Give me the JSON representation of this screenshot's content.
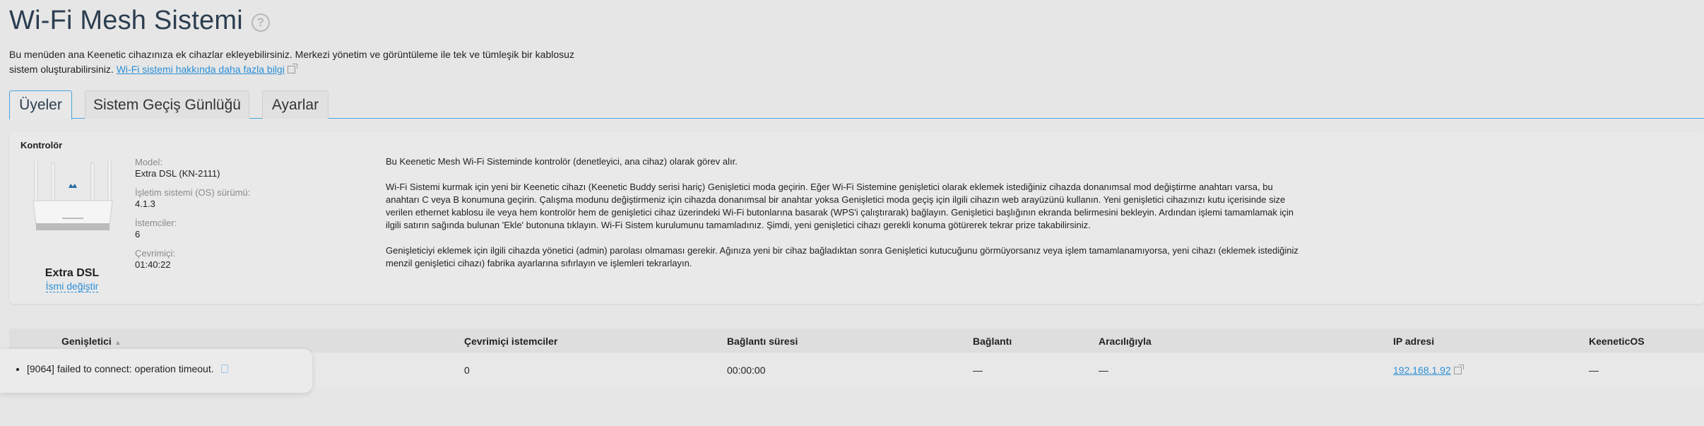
{
  "page": {
    "title": "Wi-Fi Mesh Sistemi",
    "help_icon": "?",
    "description_line1": "Bu menüden ana Keenetic cihazınıza ek cihazlar ekleyebilirsiniz. Merkezi yönetim ve görüntüleme ile tek ve tümleşik bir kablosuz",
    "description_line2": "sistem oluşturabilirsiniz.",
    "description_link": "Wi-Fi sistemi hakkında daha fazla bilgi"
  },
  "tabs": [
    {
      "label": "Üyeler",
      "active": true
    },
    {
      "label": "Sistem Geçiş Günlüğü",
      "active": false
    },
    {
      "label": "Ayarlar",
      "active": false
    }
  ],
  "controller": {
    "section_label": "Kontrolör",
    "device_name": "Extra DSL",
    "rename_link": "İsmi değiştir",
    "fields": [
      {
        "key": "Model:",
        "value": "Extra DSL (KN-2111)"
      },
      {
        "key": "İşletim sistemi (OS) sürümü:",
        "value": "4.1.3"
      },
      {
        "key": "İstemciler:",
        "value": "6"
      },
      {
        "key": "Çevrimiçi:",
        "value": "01:40:22"
      }
    ],
    "paragraphs": [
      "Bu Keenetic Mesh Wi-Fi Sisteminde kontrolör (denetleyici, ana cihaz) olarak görev alır.",
      "Wi-Fi Sistemi kurmak için yeni bir Keenetic cihazı (Keenetic Buddy serisi hariç) Genişletici moda geçirin. Eğer Wi-Fi Sistemine genişletici olarak eklemek istediğiniz cihazda donanımsal mod değiştirme anahtarı varsa, bu anahtarı C veya B konumuna geçirin. Çalışma modunu değiştirmeniz için cihazda donanımsal bir anahtar yoksa Genişletici moda geçiş için ilgili cihazın web arayüzünü kullanın. Yeni genişletici cihazınızı kutu içerisinde size verilen ethernet kablosu ile veya hem kontrolör hem de genişletici cihaz üzerindeki Wi-Fi butonlarına basarak (WPS'i çalıştırarak) bağlayın. Genişletici başlığının ekranda belirmesini bekleyin. Ardından işlemi tamamlamak için ilgili satırın sağında bulunan 'Ekle' butonuna tıklayın. Wi-Fi Sistem kurulumunu tamamladınız. Şimdi, yeni genişletici cihazı gerekli konuma götürerek tekrar prize takabilirsiniz.",
      "Genişleticiyi eklemek için ilgili cihazda yönetici (admin) parolası olmaması gerekir. Ağınıza yeni bir cihaz bağladıktan sonra Genişletici kutucuğunu görmüyorsanız veya işlem tamamlanamıyorsa, yeni cihazı (eklemek istediğiniz menzil genişletici cihazı) fabrika ayarlarına sıfırlayın ve işlemleri tekrarlayın."
    ]
  },
  "table": {
    "headers": [
      "Genişletici",
      "Çevrimiçi istemciler",
      "Bağlantı süresi",
      "Bağlantı",
      "Aracılığıyla",
      "IP adresi",
      "KeeneticOS"
    ],
    "sort_indicator": "▲",
    "row": {
      "online_clients": "0",
      "connection_time": "00:00:00",
      "connection": "—",
      "via": "—",
      "ip": "192.168.1.92",
      "keeneticos": "—"
    }
  },
  "toast": {
    "message": "[9064] failed to connect: operation timeout."
  },
  "colors": {
    "accent": "#2b8fd6",
    "title": "#2c3e50",
    "background": "#e6e6e6"
  }
}
